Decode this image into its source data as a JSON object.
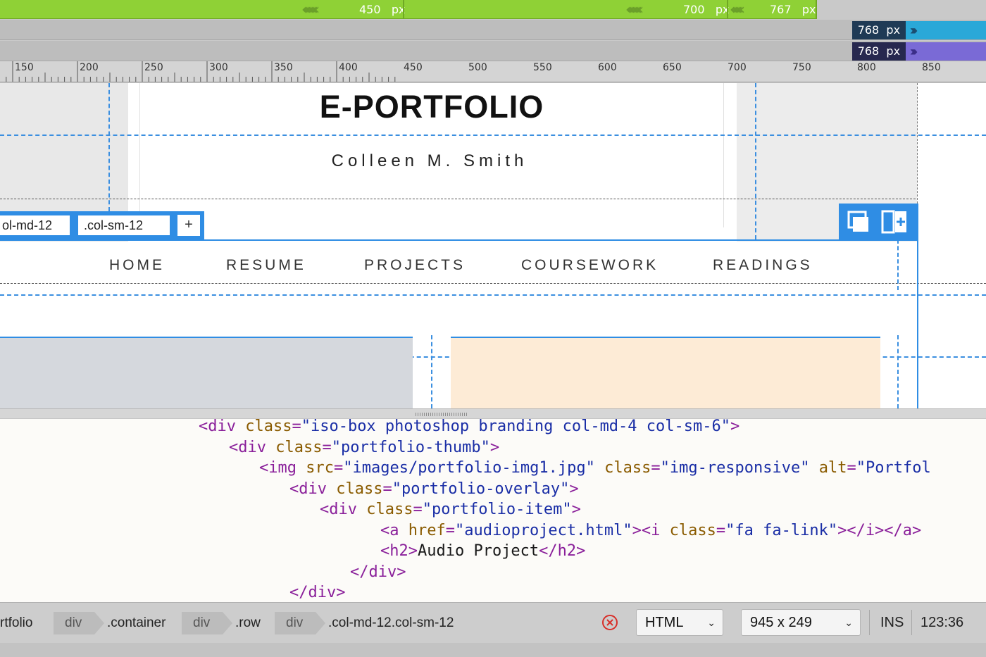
{
  "media_queries": {
    "green_bar": [
      {
        "value": "450",
        "unit": "px"
      },
      {
        "value": "700",
        "unit": "px"
      },
      {
        "value": "767",
        "unit": "px"
      }
    ],
    "cyan_pill": {
      "value": "768",
      "unit": "px",
      "color": "#2aa8d8"
    },
    "purple_pill": {
      "value": "768",
      "unit": "px",
      "color": "#7a6ad6"
    }
  },
  "ruler": {
    "labels": [
      "150",
      "200",
      "250",
      "300",
      "350",
      "400",
      "450",
      "500",
      "550",
      "600",
      "650",
      "700",
      "750",
      "800",
      "850"
    ]
  },
  "design": {
    "title": "E-PORTFOLIO",
    "subtitle": "Colleen M. Smith",
    "class_tabs": [
      "ol-md-12",
      ".col-sm-12"
    ],
    "add_tab_label": "+",
    "nav": [
      "HOME",
      "RESUME",
      "PROJECTS",
      "COURSEWORK",
      "READINGS"
    ]
  },
  "code": {
    "lines": [
      [
        {
          "c": "tg",
          "t": "<div "
        },
        {
          "c": "at",
          "t": "class"
        },
        {
          "c": "tg",
          "t": "="
        },
        {
          "c": "st",
          "t": "\"iso-box photoshop branding col-md-4 col-sm-6\""
        },
        {
          "c": "tg",
          "t": ">"
        }
      ],
      [
        {
          "c": "tg",
          "t": "<div "
        },
        {
          "c": "at",
          "t": "class"
        },
        {
          "c": "tg",
          "t": "="
        },
        {
          "c": "st",
          "t": "\"portfolio-thumb\""
        },
        {
          "c": "tg",
          "t": ">"
        }
      ],
      [
        {
          "c": "tg",
          "t": "<img "
        },
        {
          "c": "at",
          "t": "src"
        },
        {
          "c": "tg",
          "t": "="
        },
        {
          "c": "st",
          "t": "\"images/portfolio-img1.jpg\""
        },
        {
          "c": "tx",
          "t": " "
        },
        {
          "c": "at",
          "t": "class"
        },
        {
          "c": "tg",
          "t": "="
        },
        {
          "c": "st",
          "t": "\"img-responsive\""
        },
        {
          "c": "tx",
          "t": " "
        },
        {
          "c": "at",
          "t": "alt"
        },
        {
          "c": "tg",
          "t": "="
        },
        {
          "c": "st",
          "t": "\"Portfol"
        }
      ],
      [
        {
          "c": "tg",
          "t": "<div "
        },
        {
          "c": "at",
          "t": "class"
        },
        {
          "c": "tg",
          "t": "="
        },
        {
          "c": "st",
          "t": "\"portfolio-overlay\""
        },
        {
          "c": "tg",
          "t": ">"
        }
      ],
      [
        {
          "c": "tg",
          "t": "<div "
        },
        {
          "c": "at",
          "t": "class"
        },
        {
          "c": "tg",
          "t": "="
        },
        {
          "c": "st",
          "t": "\"portfolio-item\""
        },
        {
          "c": "tg",
          "t": ">"
        }
      ],
      [
        {
          "c": "tg",
          "t": "<a "
        },
        {
          "c": "at",
          "t": "href"
        },
        {
          "c": "tg",
          "t": "="
        },
        {
          "c": "st",
          "t": "\"audioproject.html\""
        },
        {
          "c": "tg",
          "t": "><i "
        },
        {
          "c": "at",
          "t": "class"
        },
        {
          "c": "tg",
          "t": "="
        },
        {
          "c": "st",
          "t": "\"fa fa-link\""
        },
        {
          "c": "tg",
          "t": "></i></a>"
        }
      ],
      [
        {
          "c": "tg",
          "t": "<h2>"
        },
        {
          "c": "tx",
          "t": "Audio Project"
        },
        {
          "c": "tg",
          "t": "</h2>"
        }
      ],
      [
        {
          "c": "tg",
          "t": "</div>"
        }
      ],
      [
        {
          "c": "tg",
          "t": "</div>"
        }
      ]
    ]
  },
  "status_bar": {
    "breadcrumbs": [
      "rtfolio",
      "div",
      ".container",
      "div",
      ".row",
      "div",
      ".col-md-12.col-sm-12"
    ],
    "doc_type": "HTML",
    "dimensions": "945 x 249",
    "mode": "INS",
    "cursor": "123:36"
  }
}
